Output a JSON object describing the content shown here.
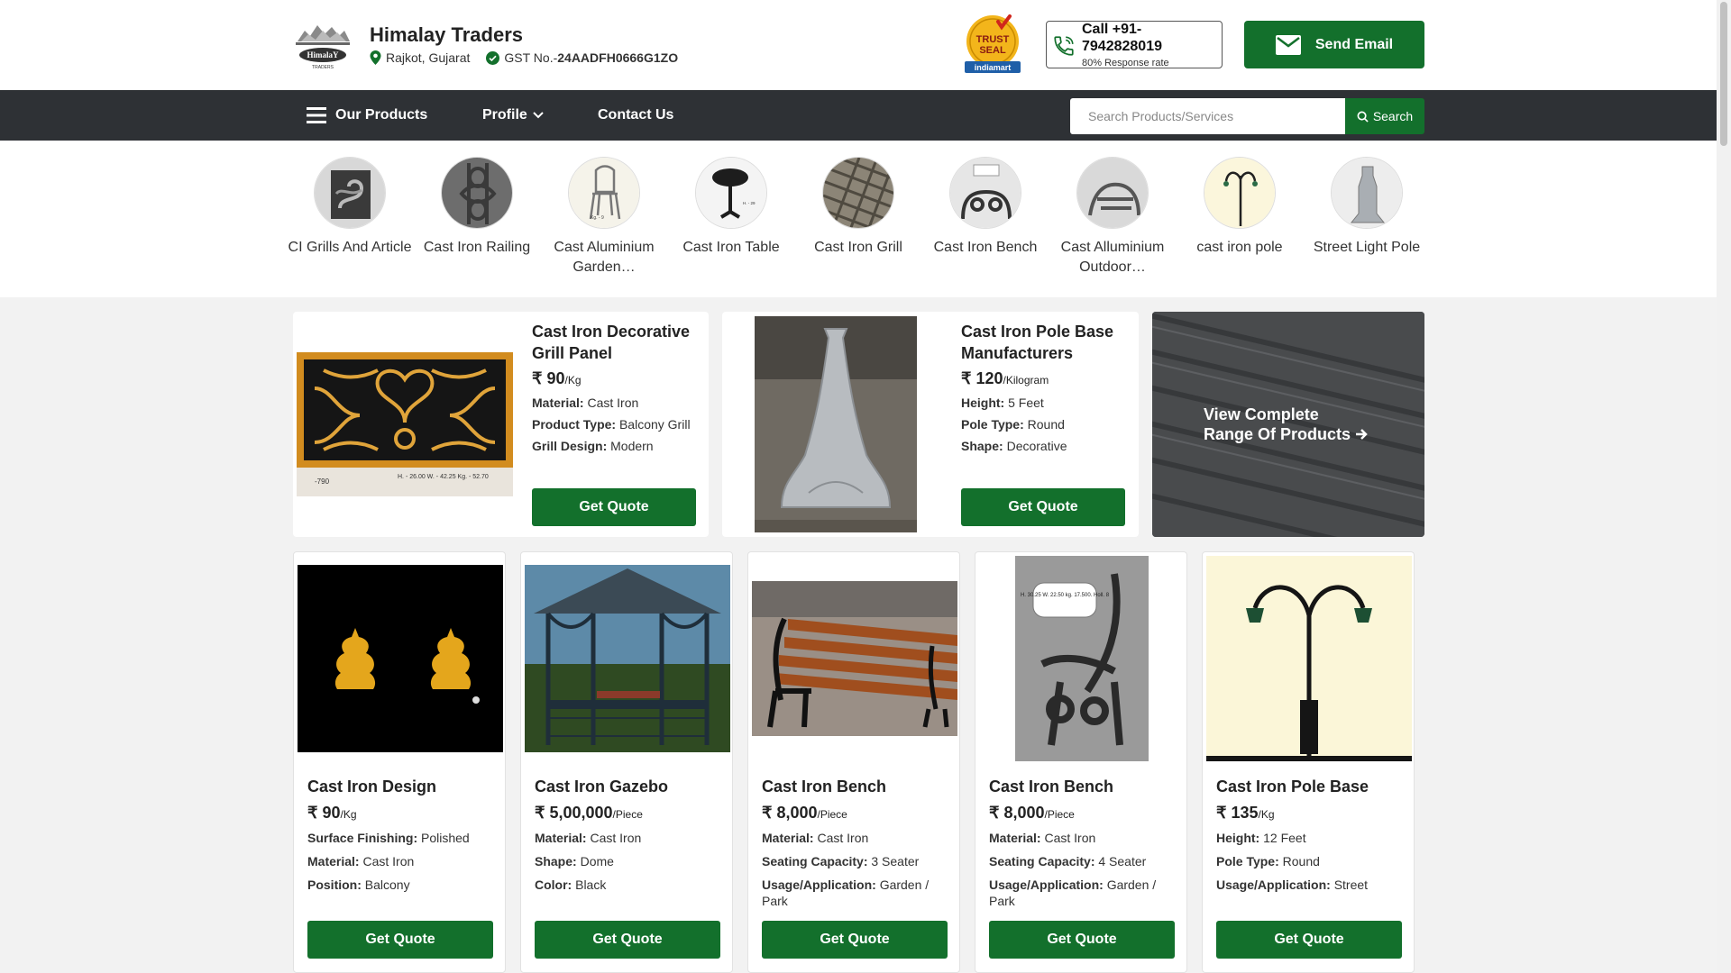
{
  "header": {
    "company_name": "Himalay Traders",
    "location": "Rajkot, Gujarat",
    "gst_label": "GST No.-",
    "gst_number": "24AADFH0666G1ZO",
    "logo_text": "HimalaY",
    "logo_subtext": "TRADERS",
    "trust_seal": {
      "line1": "TRUST",
      "line2": "SEAL",
      "brand": "indiamart"
    },
    "call_label": "Call +91-7942828019",
    "response_rate": "80% Response rate",
    "send_email_label": "Send Email"
  },
  "nav": {
    "our_products": "Our Products",
    "profile": "Profile",
    "contact_us": "Contact Us",
    "search_placeholder": "Search Products/Services",
    "search_label": "Search"
  },
  "categories": [
    {
      "label": "CI Grills And Article"
    },
    {
      "label": "Cast Iron Railing"
    },
    {
      "label": "Cast Aluminium Garden…"
    },
    {
      "label": "Cast Iron Table"
    },
    {
      "label": "Cast Iron Grill"
    },
    {
      "label": "Cast Iron Bench"
    },
    {
      "label": "Cast Alluminium Outdoor…"
    },
    {
      "label": "cast iron pole"
    },
    {
      "label": "Street Light Pole"
    }
  ],
  "featured": [
    {
      "title": "Cast Iron Decorative Grill Panel",
      "price": "₹ 90",
      "unit": "/Kg",
      "specs": [
        {
          "key": "Material: ",
          "value": "Cast Iron"
        },
        {
          "key": "Product Type: ",
          "value": "Balcony Grill"
        },
        {
          "key": "Grill Design: ",
          "value": "Modern"
        }
      ],
      "image_caption": "H. - 26.00 W. - 42.25 Kg. - 52.70",
      "image_code": "-790",
      "button": "Get Quote"
    },
    {
      "title": "Cast Iron Pole Base Manufacturers",
      "price": "₹ 120",
      "unit": "/Kilogram",
      "specs": [
        {
          "key": "Height: ",
          "value": "5 Feet"
        },
        {
          "key": "Pole Type: ",
          "value": "Round"
        },
        {
          "key": "Shape: ",
          "value": "Decorative"
        }
      ],
      "button": "Get Quote"
    }
  ],
  "view_range": {
    "line1": "View Complete",
    "line2": "Range Of Products"
  },
  "products": [
    {
      "title": "Cast Iron Design",
      "price": "₹ 90",
      "unit": "/Kg",
      "specs": [
        {
          "key": "Surface Finishing: ",
          "value": "Polished"
        },
        {
          "key": "Material: ",
          "value": "Cast Iron"
        },
        {
          "key": "Position: ",
          "value": "Balcony"
        }
      ],
      "button": "Get Quote"
    },
    {
      "title": "Cast Iron Gazebo",
      "price": "₹ 5,00,000",
      "unit": "/Piece",
      "specs": [
        {
          "key": "Material: ",
          "value": "Cast Iron"
        },
        {
          "key": "Shape: ",
          "value": "Dome"
        },
        {
          "key": "Color: ",
          "value": "Black"
        }
      ],
      "button": "Get Quote"
    },
    {
      "title": "Cast Iron Bench",
      "price": "₹ 8,000",
      "unit": "/Piece",
      "specs": [
        {
          "key": "Material: ",
          "value": "Cast Iron"
        },
        {
          "key": "Seating Capacity: ",
          "value": "3 Seater"
        },
        {
          "key": "Usage/Application: ",
          "value": "Garden / Park"
        }
      ],
      "button": "Get Quote"
    },
    {
      "title": "Cast Iron Bench",
      "price": "₹ 8,000",
      "unit": "/Piece",
      "specs": [
        {
          "key": "Material: ",
          "value": "Cast Iron"
        },
        {
          "key": "Seating Capacity: ",
          "value": "4 Seater"
        },
        {
          "key": "Usage/Application: ",
          "value": "Garden / Park"
        }
      ],
      "image_caption": "H. 30.25 W. 22.50 kg. 17.500. Holl. 8",
      "button": "Get Quote"
    },
    {
      "title": "Cast Iron Pole Base",
      "price": "₹ 135",
      "unit": "/Kg",
      "specs": [
        {
          "key": "Height: ",
          "value": "12 Feet"
        },
        {
          "key": "Pole Type: ",
          "value": "Round"
        },
        {
          "key": "Usage/Application: ",
          "value": "Street"
        }
      ],
      "button": "Get Quote"
    }
  ],
  "colors": {
    "brand_green": "#13702c",
    "nav_bg": "#2e3135",
    "page_bg": "#f2f2f2"
  }
}
